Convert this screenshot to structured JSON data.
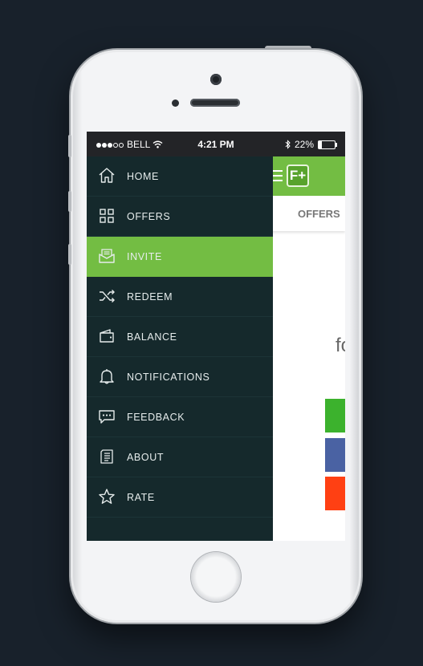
{
  "status_bar": {
    "carrier": "BELL",
    "time": "4:21 PM",
    "battery_percent": "22%",
    "battery_level": 0.22,
    "icons": [
      "signal-dots-icon",
      "wifi-icon",
      "bluetooth-icon",
      "battery-icon"
    ]
  },
  "drawer": {
    "items": [
      {
        "label": "HOME",
        "icon": "home-icon",
        "active": false
      },
      {
        "label": "OFFERS",
        "icon": "grid-icon",
        "active": false
      },
      {
        "label": "INVITE",
        "icon": "envelope-icon",
        "active": true
      },
      {
        "label": "REDEEM",
        "icon": "shuffle-icon",
        "active": false
      },
      {
        "label": "BALANCE",
        "icon": "wallet-icon",
        "active": false
      },
      {
        "label": "NOTIFICATIONS",
        "icon": "bell-icon",
        "active": false
      },
      {
        "label": "FEEDBACK",
        "icon": "chat-bubble-icon",
        "active": false
      },
      {
        "label": "ABOUT",
        "icon": "document-icon",
        "active": false
      },
      {
        "label": "RATE",
        "icon": "star-icon",
        "active": false
      }
    ]
  },
  "app": {
    "logo_text": "F+",
    "tab_label": "OFFERS",
    "partial_text": "fo",
    "swatch_colors": [
      "#3cb22d",
      "#4a62a3",
      "#ff4013"
    ],
    "accent_color": "#73bd43",
    "drawer_color": "#15292c"
  }
}
